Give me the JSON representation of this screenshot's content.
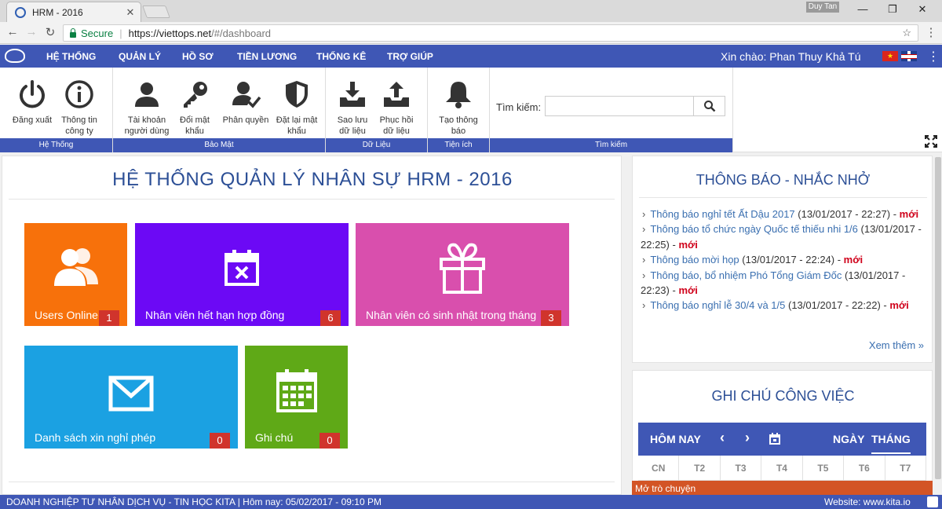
{
  "browser": {
    "tab_title": "HRM - 2016",
    "user_chip": "Duy Tan",
    "secure_label": "Secure",
    "url_host": "https://viettops.net",
    "url_path": "/#/dashboard"
  },
  "nav": {
    "items": [
      "HỆ THỐNG",
      "QUẢN LÝ",
      "HỒ SƠ",
      "TIỀN LƯƠNG",
      "THỐNG KÊ",
      "TRỢ GIÚP"
    ],
    "greeting": "Xin chào: Phan Thuy Khả Tú",
    "flag_vn_star": "★"
  },
  "ribbon": {
    "groups": {
      "system": "Hệ Thống",
      "security": "Bảo Mật",
      "data": "Dữ Liệu",
      "utility": "Tiện ích",
      "search": "Tìm kiếm"
    },
    "buttons": {
      "logout": "Đăng xuất",
      "company_info": "Thông tin công ty",
      "user_account": "Tài khoản người dùng",
      "change_password": "Đổi mật khẩu",
      "permission": "Phân quyền",
      "reset_password": "Đặt lại mật khẩu",
      "backup": "Sao lưu dữ liệu",
      "restore": "Phục hồi dữ liệu",
      "create_notice": "Tạo thông báo"
    },
    "search_label": "Tìm kiếm:",
    "search_value": ""
  },
  "main": {
    "title": "HỆ THỐNG QUẢN LÝ NHÂN SỰ HRM - 2016",
    "tiles": [
      {
        "label": "Users Online",
        "count": "1",
        "color": "#f7710b"
      },
      {
        "label": "Nhân viên hết hạn hợp đồng",
        "count": "6",
        "color": "#6c09f5"
      },
      {
        "label": "Nhân viên có sinh nhật trong tháng",
        "count": "3",
        "color": "#d94fad"
      },
      {
        "label": "Danh sách xin nghỉ phép",
        "count": "0",
        "color": "#1ba1e2"
      },
      {
        "label": "Ghi chú",
        "count": "0",
        "color": "#5fa917"
      }
    ]
  },
  "notices": {
    "title": "THÔNG BÁO - NHẮC NHỞ",
    "items": [
      {
        "text": "Thông báo nghỉ tết Ất Dậu 2017",
        "time": "(13/01/2017 - 22:27) -",
        "flag": "mới"
      },
      {
        "text": "Thông báo tổ chức ngày Quốc tế thiếu nhi 1/6",
        "time": "(13/01/2017 - 22:25) -",
        "flag": "mới"
      },
      {
        "text": "Thông báo mời họp",
        "time": "(13/01/2017 - 22:24) -",
        "flag": "mới"
      },
      {
        "text": "Thông báo, bổ nhiệm Phó Tổng Giám Đốc",
        "time": "(13/01/2017 - 22:23) -",
        "flag": "mới"
      },
      {
        "text": "Thông báo nghỉ lễ 30/4 và 1/5",
        "time": "(13/01/2017 - 22:22) -",
        "flag": "mới"
      }
    ],
    "more": "Xem thêm »"
  },
  "tasks": {
    "title": "GHI CHÚ CÔNG VIỆC",
    "today": "HÔM NAY",
    "prev": "‹",
    "next": "›",
    "day_view": "NGÀY",
    "month_view": "THÁNG",
    "weekdays": [
      "CN",
      "T2",
      "T3",
      "T4",
      "T5",
      "T6",
      "T7"
    ]
  },
  "chat": {
    "label": "Mở trò chuyện"
  },
  "footer": {
    "left": "DOANH NGHIỆP TƯ NHÂN DỊCH VỤ - TIN HỌC KITA | Hôm nay: 05/02/2017 - 09:10 PM",
    "right": "Website: www.kita.io"
  }
}
